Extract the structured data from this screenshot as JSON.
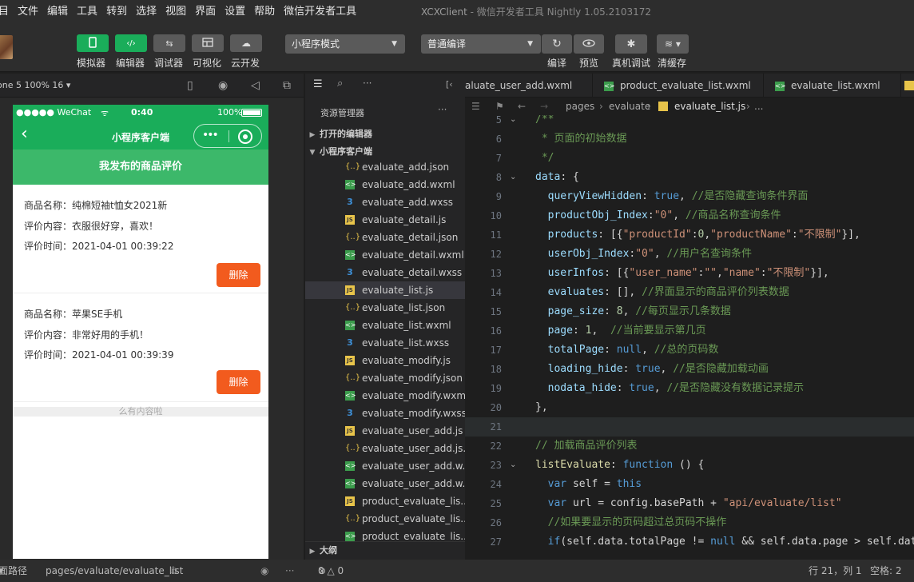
{
  "menubar": {
    "items": [
      "目",
      "文件",
      "编辑",
      "工具",
      "转到",
      "选择",
      "视图",
      "界面",
      "设置",
      "帮助",
      "微信开发者工具"
    ],
    "window_title": "XCXClient",
    "window_subtitle": " - 微信开发者工具 Nightly 1.05.2103172"
  },
  "toolbar": {
    "buttons": [
      {
        "label": "模拟器",
        "icon": "phone-icon"
      },
      {
        "label": "编辑器",
        "icon": "code-icon"
      },
      {
        "label": "调试器",
        "icon": "debug-icon"
      },
      {
        "label": "可视化",
        "icon": "layout-icon"
      },
      {
        "label": "云开发",
        "icon": "cloud-icon"
      }
    ],
    "mode_select": "小程序模式",
    "compile_select": "普通编译",
    "right_buttons": [
      {
        "label": "编译",
        "icon": "refresh-icon"
      },
      {
        "label": "预览",
        "icon": "eye-icon"
      },
      {
        "label": "真机调试",
        "icon": "bug-icon"
      },
      {
        "label": "清缓存",
        "icon": "layers-icon"
      }
    ]
  },
  "simulator": {
    "device": "one 5 100% 16",
    "status_carrier": "●●●●● WeChat",
    "status_time": "0:40",
    "status_battery": "100%",
    "nav_title": "小程序客户端",
    "capsule_dots": "•••",
    "page_banner": "我发布的商品评价",
    "reviews": [
      {
        "name": "商品名称：纯棉短袖t恤女2021新",
        "content": "评价内容：衣服很好穿，喜欢！",
        "time": "评价时间：2021-04-01 00:39:22",
        "button": "删除"
      },
      {
        "name": "商品名称：苹果SE手机",
        "content": "评价内容：非常好用的手机！",
        "time": "评价时间：2021-04-01 00:39:39",
        "button": "删除"
      }
    ],
    "no_content": "么有内容啦"
  },
  "explorer": {
    "title": "资源管理器",
    "more": "···",
    "sections": {
      "open_editors": "打开的编辑器",
      "project": "小程序客户端",
      "outline": "大纲"
    },
    "files": [
      {
        "name": "evaluate_add.json",
        "type": "json"
      },
      {
        "name": "evaluate_add.wxml",
        "type": "wxml"
      },
      {
        "name": "evaluate_add.wxss",
        "type": "wxss"
      },
      {
        "name": "evaluate_detail.js",
        "type": "js"
      },
      {
        "name": "evaluate_detail.json",
        "type": "json"
      },
      {
        "name": "evaluate_detail.wxml",
        "type": "wxml"
      },
      {
        "name": "evaluate_detail.wxss",
        "type": "wxss"
      },
      {
        "name": "evaluate_list.js",
        "type": "js"
      },
      {
        "name": "evaluate_list.json",
        "type": "json"
      },
      {
        "name": "evaluate_list.wxml",
        "type": "wxml"
      },
      {
        "name": "evaluate_list.wxss",
        "type": "wxss"
      },
      {
        "name": "evaluate_modify.js",
        "type": "js"
      },
      {
        "name": "evaluate_modify.json",
        "type": "json"
      },
      {
        "name": "evaluate_modify.wxml",
        "type": "wxml"
      },
      {
        "name": "evaluate_modify.wxss",
        "type": "wxss"
      },
      {
        "name": "evaluate_user_add.js",
        "type": "js"
      },
      {
        "name": "evaluate_user_add.js...",
        "type": "json"
      },
      {
        "name": "evaluate_user_add.w...",
        "type": "wxml"
      },
      {
        "name": "evaluate_user_add.w...",
        "type": "wxml"
      },
      {
        "name": "product_evaluate_lis...",
        "type": "js"
      },
      {
        "name": "product_evaluate_lis...",
        "type": "json"
      },
      {
        "name": "product_evaluate_lis...",
        "type": "wxml"
      }
    ]
  },
  "editor": {
    "tabs": [
      "aluate_user_add.wxml",
      "product_evaluate_list.wxml",
      "evaluate_list.wxml"
    ],
    "breadcrumb": [
      "pages",
      "evaluate",
      "evaluate_list.js",
      "..."
    ],
    "lines": [
      {
        "n": "5",
        "tokens": [
          [
            "c-cm",
            "/**"
          ]
        ]
      },
      {
        "n": "6",
        "tokens": [
          [
            "c-cm",
            " * 页面的初始数据"
          ]
        ]
      },
      {
        "n": "7",
        "tokens": [
          [
            "c-cm",
            " */"
          ]
        ]
      },
      {
        "n": "8",
        "tokens": [
          [
            "c-prop",
            "data"
          ],
          [
            "c-txt",
            ": {"
          ]
        ]
      },
      {
        "n": "9",
        "tokens": [
          [
            "c-prop",
            "  queryViewHidden"
          ],
          [
            "c-txt",
            ": "
          ],
          [
            "c-kw",
            "true"
          ],
          [
            "c-txt",
            ", "
          ],
          [
            "c-cm",
            "//是否隐藏查询条件界面"
          ]
        ]
      },
      {
        "n": "10",
        "tokens": [
          [
            "c-prop",
            "  productObj_Index"
          ],
          [
            "c-txt",
            ":"
          ],
          [
            "c-str",
            "\"0\""
          ],
          [
            "c-txt",
            ", "
          ],
          [
            "c-cm",
            "//商品名称查询条件"
          ]
        ]
      },
      {
        "n": "11",
        "tokens": [
          [
            "c-prop",
            "  products"
          ],
          [
            "c-txt",
            ": [{"
          ],
          [
            "c-str",
            "\"productId\""
          ],
          [
            "c-txt",
            ":"
          ],
          [
            "c-num",
            "0"
          ],
          [
            "c-txt",
            ","
          ],
          [
            "c-str",
            "\"productName\""
          ],
          [
            "c-txt",
            ":"
          ],
          [
            "c-str",
            "\"不限制\""
          ],
          [
            "c-txt",
            "}],"
          ]
        ]
      },
      {
        "n": "12",
        "tokens": [
          [
            "c-prop",
            "  userObj_Index"
          ],
          [
            "c-txt",
            ":"
          ],
          [
            "c-str",
            "\"0\""
          ],
          [
            "c-txt",
            ", "
          ],
          [
            "c-cm",
            "//用户名查询条件"
          ]
        ]
      },
      {
        "n": "13",
        "tokens": [
          [
            "c-prop",
            "  userInfos"
          ],
          [
            "c-txt",
            ": [{"
          ],
          [
            "c-str",
            "\"user_name\""
          ],
          [
            "c-txt",
            ":"
          ],
          [
            "c-str",
            "\"\""
          ],
          [
            "c-txt",
            ","
          ],
          [
            "c-str",
            "\"name\""
          ],
          [
            "c-txt",
            ":"
          ],
          [
            "c-str",
            "\"不限制\""
          ],
          [
            "c-txt",
            "}],"
          ]
        ]
      },
      {
        "n": "14",
        "tokens": [
          [
            "c-prop",
            "  evaluates"
          ],
          [
            "c-txt",
            ": [], "
          ],
          [
            "c-cm",
            "//界面显示的商品评价列表数据"
          ]
        ]
      },
      {
        "n": "15",
        "tokens": [
          [
            "c-prop",
            "  page_size"
          ],
          [
            "c-txt",
            ": "
          ],
          [
            "c-num",
            "8"
          ],
          [
            "c-txt",
            ", "
          ],
          [
            "c-cm",
            "//每页显示几条数据"
          ]
        ]
      },
      {
        "n": "16",
        "tokens": [
          [
            "c-prop",
            "  page"
          ],
          [
            "c-txt",
            ": "
          ],
          [
            "c-num",
            "1"
          ],
          [
            "c-txt",
            ",  "
          ],
          [
            "c-cm",
            "//当前要显示第几页"
          ]
        ]
      },
      {
        "n": "17",
        "tokens": [
          [
            "c-prop",
            "  totalPage"
          ],
          [
            "c-txt",
            ": "
          ],
          [
            "c-kw",
            "null"
          ],
          [
            "c-txt",
            ", "
          ],
          [
            "c-cm",
            "//总的页码数"
          ]
        ]
      },
      {
        "n": "18",
        "tokens": [
          [
            "c-prop",
            "  loading_hide"
          ],
          [
            "c-txt",
            ": "
          ],
          [
            "c-kw",
            "true"
          ],
          [
            "c-txt",
            ", "
          ],
          [
            "c-cm",
            "//是否隐藏加载动画"
          ]
        ]
      },
      {
        "n": "19",
        "tokens": [
          [
            "c-prop",
            "  nodata_hide"
          ],
          [
            "c-txt",
            ": "
          ],
          [
            "c-kw",
            "true"
          ],
          [
            "c-txt",
            ", "
          ],
          [
            "c-cm",
            "//是否隐藏没有数据记录提示"
          ]
        ]
      },
      {
        "n": "20",
        "tokens": [
          [
            "c-txt",
            "},"
          ]
        ]
      },
      {
        "n": "21",
        "tokens": [
          [
            "c-txt",
            ""
          ]
        ]
      },
      {
        "n": "22",
        "tokens": [
          [
            "c-cm",
            "// 加载商品评价列表"
          ]
        ]
      },
      {
        "n": "23",
        "tokens": [
          [
            "c-fn",
            "listEvaluate"
          ],
          [
            "c-txt",
            ": "
          ],
          [
            "c-kw",
            "function"
          ],
          [
            "c-txt",
            " () {"
          ]
        ]
      },
      {
        "n": "24",
        "tokens": [
          [
            "c-kw",
            "  var"
          ],
          [
            "c-txt",
            " self = "
          ],
          [
            "c-kw",
            "this"
          ]
        ]
      },
      {
        "n": "25",
        "tokens": [
          [
            "c-kw",
            "  var"
          ],
          [
            "c-txt",
            " url = config.basePath + "
          ],
          [
            "c-str",
            "\"api/evaluate/list\""
          ]
        ]
      },
      {
        "n": "26",
        "tokens": [
          [
            "c-cm",
            "  //如果要显示的页码超过总页码不操作"
          ]
        ]
      },
      {
        "n": "27",
        "tokens": [
          [
            "c-kw",
            "  if"
          ],
          [
            "c-txt",
            "(self.data.totalPage != "
          ],
          [
            "c-kw",
            "null"
          ],
          [
            "c-txt",
            " && self.data.page > self.data"
          ]
        ]
      }
    ]
  },
  "statusbar": {
    "path_label": "面路径",
    "path": "pages/evaluate/evaluate_list",
    "problems": "0 △ 0",
    "cursor": "行 21，列 1",
    "indent": "空格: 2"
  },
  "colors": {
    "wechat_green": "#1aad5a",
    "delete_orange": "#f25b1e",
    "editor_bg": "#1e1e1e"
  }
}
